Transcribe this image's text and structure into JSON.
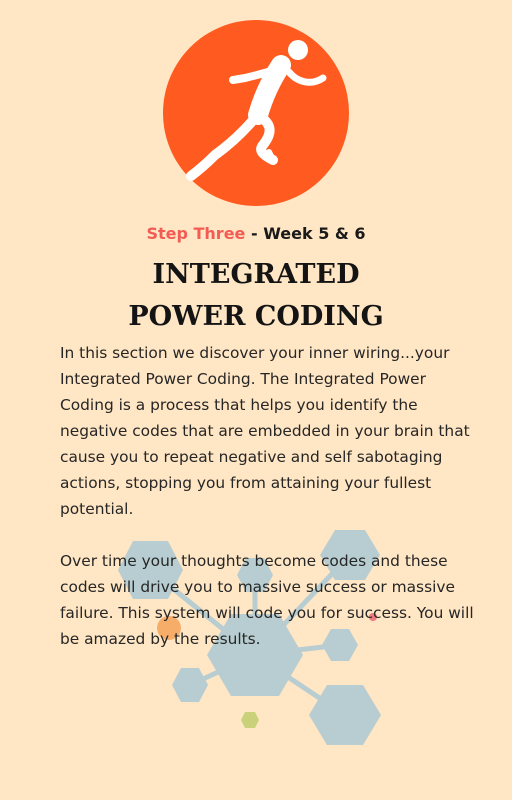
{
  "header": {
    "step_label": "Step Three",
    "step_suffix": "- Week 5 & 6"
  },
  "title": {
    "line1": "INTEGRATED",
    "line2": "POWER CODING"
  },
  "body": {
    "paragraph1": "In this section we discover your inner wiring...your Integrated Power Coding. The Integrated Power Coding is a process that helps you identify the negative codes that are embedded in your brain that cause you to repeat negative and self sabotaging actions, stopping you from attaining your fullest potential.",
    "paragraph2": "Over time your thoughts become codes and these codes will drive you to massive success or massive failure. This system will code you for success. You will be amazed by the results."
  },
  "colors": {
    "background": "#ffe6c4",
    "logo_circle": "#ff5a1f",
    "step_accent": "#f25c54",
    "hexagon": "#b8cdd1"
  },
  "icons": {
    "logo": "running-man-icon"
  }
}
